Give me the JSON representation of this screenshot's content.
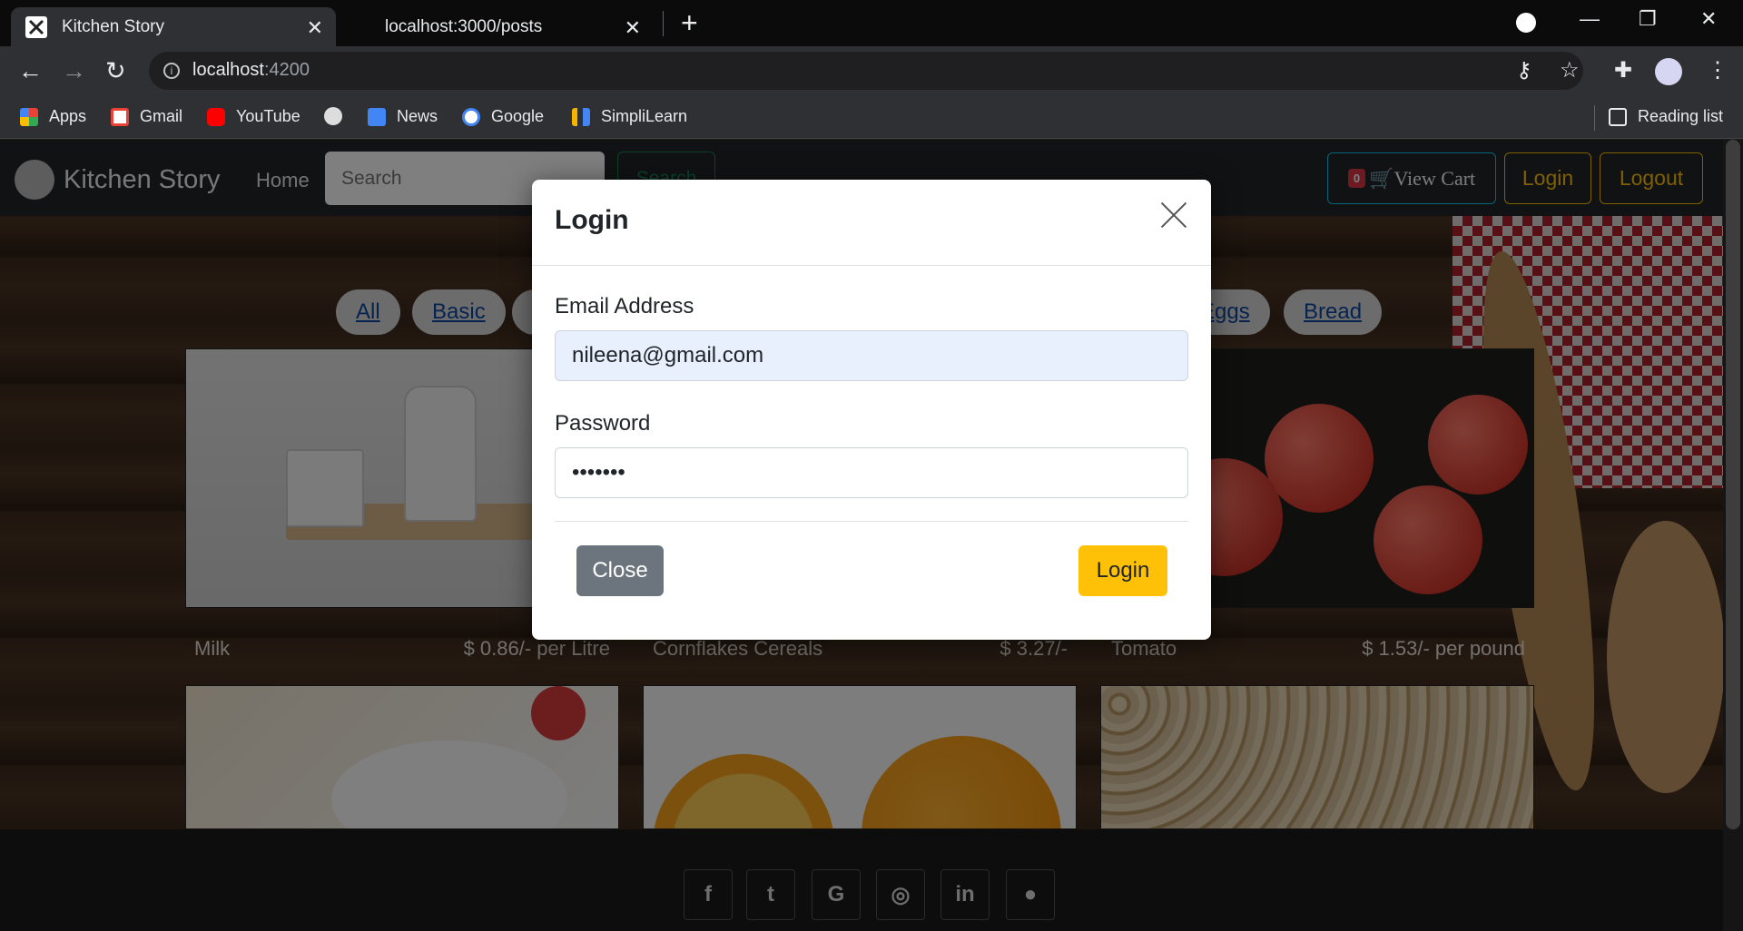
{
  "browser": {
    "tabs": [
      {
        "title": "Kitchen Story",
        "active": true
      },
      {
        "title": "localhost:3000/posts",
        "active": false
      }
    ],
    "url_host": "localhost",
    "url_port": ":4200",
    "bookmarks": [
      "Apps",
      "Gmail",
      "YouTube",
      "News",
      "Google",
      "SimpliLearn"
    ],
    "reading_list": "Reading list"
  },
  "navbar": {
    "brand": "Kitchen Story",
    "home": "Home",
    "search_placeholder": "Search",
    "search_button": "Search",
    "cart_count": "0",
    "cart_label": "View Cart",
    "login": "Login",
    "logout": "Logout"
  },
  "categories": [
    "All",
    "Basic",
    "Eggs",
    "Bread"
  ],
  "products": [
    {
      "name": "Milk",
      "price": "$ 0.86/- per Litre"
    },
    {
      "name": "Cornflakes Cereals",
      "price": "$ 3.27/-"
    },
    {
      "name": "Tomato",
      "price": "$ 1.53/- per pound"
    }
  ],
  "modal": {
    "title": "Login",
    "email_label": "Email Address",
    "email_value": "nileena@gmail.com",
    "password_label": "Password",
    "password_value": "•••••••",
    "close_button": "Close",
    "login_button": "Login"
  },
  "colors": {
    "brand_yellow": "#ffc107",
    "secondary": "#6c757d",
    "navbar_bg": "#212529",
    "autofill_bg": "#e8f0fe"
  }
}
